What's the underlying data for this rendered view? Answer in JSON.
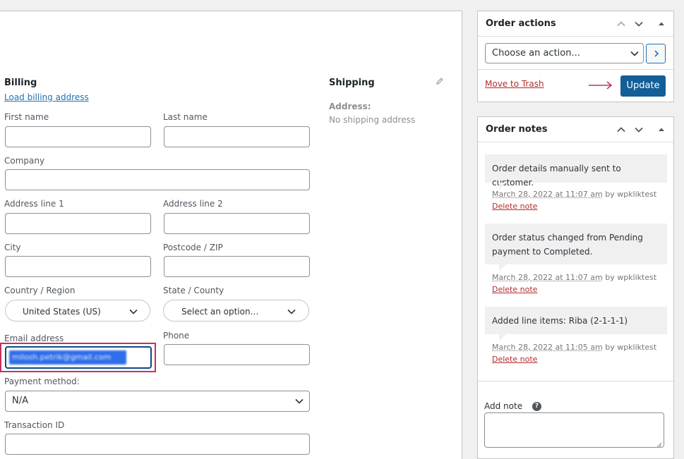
{
  "billing": {
    "title": "Billing",
    "load_link": "Load billing address",
    "first_name_label": "First name",
    "last_name_label": "Last name",
    "company_label": "Company",
    "address1_label": "Address line 1",
    "address2_label": "Address line 2",
    "city_label": "City",
    "postcode_label": "Postcode / ZIP",
    "country_label": "Country / Region",
    "country_value": "United States (US)",
    "state_label": "State / County",
    "state_value": "Select an option…",
    "email_label": "Email address",
    "email_value": "milosh.petrik@gmail.com",
    "phone_label": "Phone",
    "payment_label": "Payment method:",
    "payment_value": "N/A",
    "transaction_label": "Transaction ID"
  },
  "shipping": {
    "title": "Shipping",
    "address_label": "Address:",
    "address_value": "No shipping address"
  },
  "order_actions": {
    "title": "Order actions",
    "select_value": "Choose an action...",
    "trash_link": "Move to Trash",
    "update_label": "Update"
  },
  "order_notes": {
    "title": "Order notes",
    "notes": [
      {
        "text": "Order details manually sent to customer.",
        "time": "March 28, 2022 at 11:07 am",
        "by": " by wpkliktest ",
        "delete": "Delete note"
      },
      {
        "text": "Order status changed from Pending payment to Completed.",
        "time": "March 28, 2022 at 11:07 am",
        "by": " by wpkliktest ",
        "delete": "Delete note"
      },
      {
        "text": "Added line items: Riba (2-1-1-1)",
        "time": "March 28, 2022 at 11:05 am",
        "by": " by wpkliktest ",
        "delete": "Delete note"
      }
    ],
    "add_note_label": "Add note"
  },
  "colors": {
    "primary": "#135e96",
    "highlight_border": "#c3325f",
    "delete_link": "#b32d2e"
  }
}
